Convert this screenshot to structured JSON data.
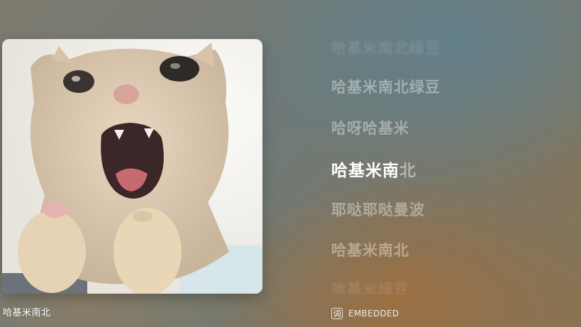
{
  "track": {
    "title": "哈基米南北"
  },
  "lyrics": {
    "lines": [
      {
        "text": "哈基米南北绿豆",
        "state": "faint"
      },
      {
        "text": "哈基米南北绿豆",
        "state": "normal"
      },
      {
        "text": "哈呀哈基米",
        "state": "normal"
      },
      {
        "text": "耶哒耶哒曼波",
        "state": "normal"
      },
      {
        "text": "哈基米南北",
        "state": "normal"
      },
      {
        "text": "哈基米绿豆",
        "state": "faint"
      }
    ],
    "current": {
      "sung": "哈基米南",
      "unsung": "北"
    }
  },
  "footer": {
    "badge_icon": "词",
    "source_label": "EMBEDDED"
  },
  "colors": {
    "active_lyric": "#ffffff",
    "inactive_lyric": "rgba(255,255,255,0.38)"
  }
}
